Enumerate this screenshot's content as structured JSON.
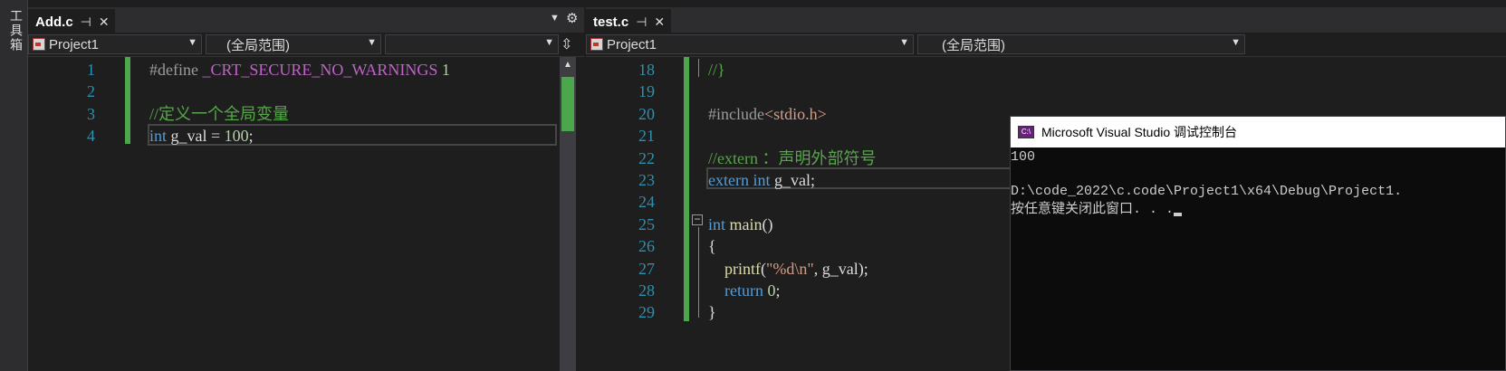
{
  "toolbox": {
    "label": "工具箱"
  },
  "left_pane": {
    "tab": {
      "name": "Add.c",
      "pin": "⊣",
      "close": "✕"
    },
    "nav": {
      "project": "Project1",
      "scope": "(全局范围)",
      "member": ""
    },
    "lines": [
      {
        "num": "1",
        "tokens": [
          [
            "pp",
            "#define "
          ],
          [
            "macro",
            "_CRT_SECURE_NO_WARNINGS"
          ],
          [
            "num",
            " 1"
          ]
        ]
      },
      {
        "num": "2",
        "tokens": []
      },
      {
        "num": "3",
        "tokens": [
          [
            "cm",
            "//定义一个全局变量"
          ]
        ]
      },
      {
        "num": "4",
        "tokens": [
          [
            "kw",
            "int"
          ],
          [
            "plain",
            " g_val = "
          ],
          [
            "num",
            "100"
          ],
          [
            "plain",
            ";"
          ]
        ]
      }
    ]
  },
  "right_pane": {
    "tab": {
      "name": "test.c",
      "pin": "⊣",
      "close": "✕"
    },
    "nav": {
      "project": "Project1",
      "scope": "(全局范围)"
    },
    "lines": [
      {
        "num": "18",
        "tokens": [
          [
            "cm",
            "//}"
          ]
        ]
      },
      {
        "num": "19",
        "tokens": []
      },
      {
        "num": "20",
        "tokens": [
          [
            "pp",
            "#include"
          ],
          [
            "str",
            "<stdio.h>"
          ]
        ]
      },
      {
        "num": "21",
        "tokens": []
      },
      {
        "num": "22",
        "tokens": [
          [
            "cm",
            "//extern ：声明外部符号"
          ]
        ]
      },
      {
        "num": "23",
        "tokens": [
          [
            "kw",
            "extern"
          ],
          [
            "plain",
            " "
          ],
          [
            "kw",
            "int"
          ],
          [
            "plain",
            " g_val;"
          ]
        ]
      },
      {
        "num": "24",
        "tokens": []
      },
      {
        "num": "25",
        "tokens": [
          [
            "kw",
            "int"
          ],
          [
            "plain",
            " "
          ],
          [
            "fn",
            "main"
          ],
          [
            "plain",
            "()"
          ]
        ]
      },
      {
        "num": "26",
        "tokens": [
          [
            "plain",
            "{"
          ]
        ]
      },
      {
        "num": "27",
        "tokens": [
          [
            "plain",
            "    "
          ],
          [
            "fn",
            "printf"
          ],
          [
            "plain",
            "("
          ],
          [
            "str",
            "\"%d\\n\""
          ],
          [
            "plain",
            ", g_val);"
          ]
        ]
      },
      {
        "num": "28",
        "tokens": [
          [
            "plain",
            "    "
          ],
          [
            "kw",
            "return"
          ],
          [
            "plain",
            " "
          ],
          [
            "num",
            "0"
          ],
          [
            "plain",
            ";"
          ]
        ]
      },
      {
        "num": "29",
        "tokens": [
          [
            "plain",
            "}"
          ]
        ]
      }
    ]
  },
  "console": {
    "title": "Microsoft Visual Studio 调试控制台",
    "icon_text": "C:\\",
    "lines": [
      "100",
      "",
      "D:\\code_2022\\c.code\\Project1\\x64\\Debug\\Project1.",
      "按任意键关闭此窗口. . ."
    ]
  },
  "colors": {
    "background": "#1e1e1e",
    "comment": "#57a64a",
    "keyword": "#569cd6",
    "macro": "#bd63c5",
    "change_marker": "#4ca64c"
  },
  "icons": [
    "toolbox-icon",
    "pin-icon",
    "close-icon",
    "dropdown-caret-icon",
    "gear-icon",
    "split-icon",
    "collapse-icon",
    "console-icon"
  ]
}
